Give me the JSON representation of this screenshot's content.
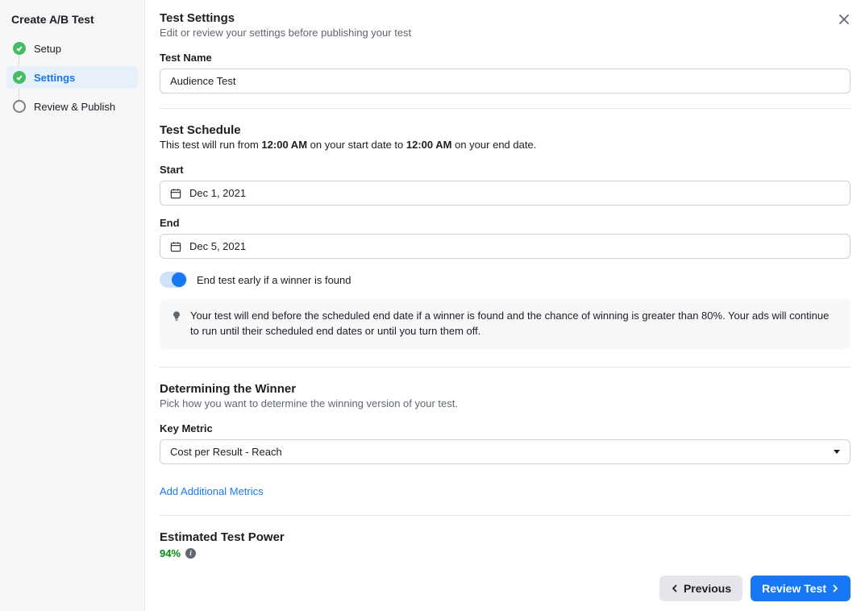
{
  "sidebar": {
    "title": "Create A/B Test",
    "steps": [
      {
        "label": "Setup",
        "state": "done"
      },
      {
        "label": "Settings",
        "state": "active"
      },
      {
        "label": "Review & Publish",
        "state": "pending"
      }
    ]
  },
  "header": {
    "title": "Test Settings",
    "description": "Edit or review your settings before publishing your test"
  },
  "testName": {
    "label": "Test Name",
    "value": "Audience Test"
  },
  "schedule": {
    "title": "Test Schedule",
    "desc_pre": "This test will run from ",
    "time_start": "12:00 AM",
    "desc_mid": " on your start date to ",
    "time_end": "12:00 AM",
    "desc_post": " on your end date.",
    "start_label": "Start",
    "start_value": "Dec 1, 2021",
    "end_label": "End",
    "end_value": "Dec 5, 2021",
    "toggle_label": "End test early if a winner is found",
    "info_text": "Your test will end before the scheduled end date if a winner is found and the chance of winning is greater than 80%. Your ads will continue to run until their scheduled end dates or until you turn them off."
  },
  "winner": {
    "title": "Determining the Winner",
    "desc": "Pick how you want to determine the winning version of your test.",
    "metric_label": "Key Metric",
    "metric_value": "Cost per Result - Reach",
    "add_link": "Add Additional Metrics"
  },
  "power": {
    "title": "Estimated Test Power",
    "value": "94%"
  },
  "footer": {
    "previous": "Previous",
    "review": "Review Test"
  }
}
